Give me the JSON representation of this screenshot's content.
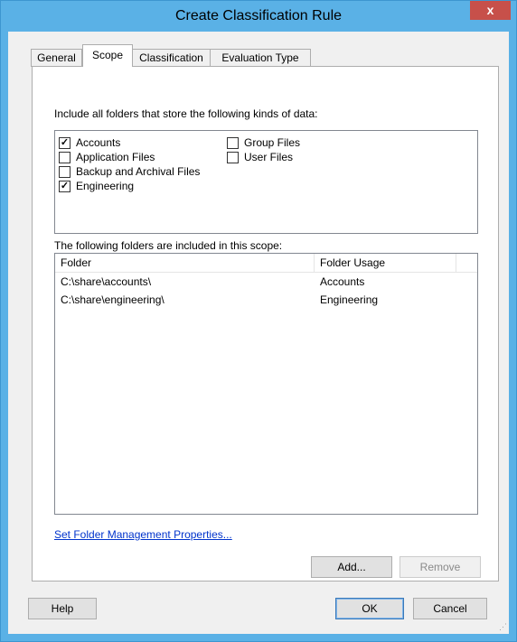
{
  "window": {
    "title": "Create Classification Rule",
    "close_glyph": "x"
  },
  "tabs": [
    {
      "label": "General"
    },
    {
      "label": "Scope"
    },
    {
      "label": "Classification"
    },
    {
      "label": "Evaluation Type"
    }
  ],
  "scope": {
    "include_heading": "Include all folders that store the following kinds of data:",
    "kinds": [
      {
        "label": "Accounts",
        "checked": true
      },
      {
        "label": "Application Files",
        "checked": false
      },
      {
        "label": "Backup and Archival Files",
        "checked": false
      },
      {
        "label": "Engineering",
        "checked": true
      },
      {
        "label": "Group Files",
        "checked": false
      },
      {
        "label": "User Files",
        "checked": false
      }
    ],
    "folders_heading": "The following folders are included in this scope:",
    "columns": {
      "folder": "Folder",
      "usage": "Folder Usage"
    },
    "rows": [
      {
        "folder": "C:\\share\\accounts\\",
        "usage": "Accounts"
      },
      {
        "folder": "C:\\share\\engineering\\",
        "usage": "Engineering"
      }
    ],
    "manage_link": "Set Folder Management Properties...",
    "add_label": "Add...",
    "remove_label": "Remove"
  },
  "footer": {
    "help_label": "Help",
    "ok_label": "OK",
    "cancel_label": "Cancel"
  },
  "check_glyph": "✓"
}
